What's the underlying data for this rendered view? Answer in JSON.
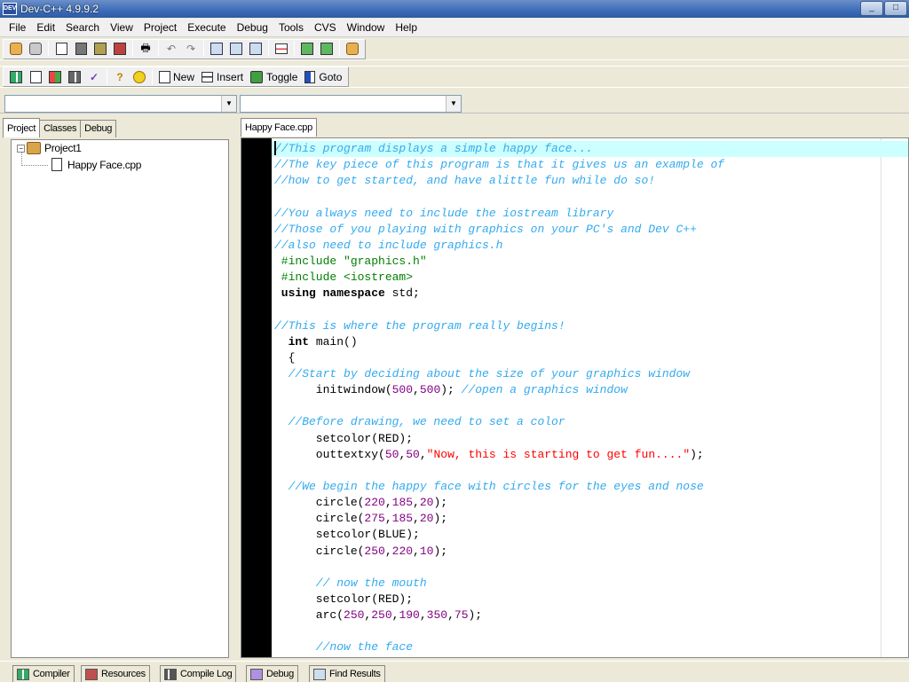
{
  "window": {
    "title": "Dev-C++ 4.9.9.2",
    "app_badge": "DEV"
  },
  "menu": [
    "File",
    "Edit",
    "Search",
    "View",
    "Project",
    "Execute",
    "Debug",
    "Tools",
    "CVS",
    "Window",
    "Help"
  ],
  "toolbar2": {
    "new_label": "New",
    "insert_label": "Insert",
    "toggle_label": "Toggle",
    "goto_label": "Goto"
  },
  "left_tabs": [
    "Project",
    "Classes",
    "Debug"
  ],
  "tree": {
    "project": "Project1",
    "file": "Happy Face.cpp"
  },
  "editor": {
    "tab_label": "Happy Face.cpp",
    "lines": [
      [
        [
          "cm",
          "//This program displays a simple happy face..."
        ]
      ],
      [
        [
          "cm",
          "//The key piece of this program is that it gives us an example of"
        ]
      ],
      [
        [
          "cm",
          "//how to get started, and have alittle fun while do so!"
        ]
      ],
      [],
      [
        [
          "cm",
          "//You always need to include the iostream library"
        ]
      ],
      [
        [
          "cm",
          "//Those of you playing with graphics on your PC's and Dev C++"
        ]
      ],
      [
        [
          "cm",
          "//also need to include graphics.h"
        ]
      ],
      [
        [
          "pp",
          " #include \"graphics.h\""
        ]
      ],
      [
        [
          "pp",
          " #include <iostream>"
        ]
      ],
      [
        [
          "kw",
          " using namespace "
        ],
        [
          "plain",
          "std;"
        ]
      ],
      [],
      [
        [
          "cm",
          "//This is where the program really begins!"
        ]
      ],
      [
        [
          "kw",
          "  int "
        ],
        [
          "plain",
          "main()"
        ]
      ],
      [
        [
          "plain",
          "  {"
        ]
      ],
      [
        [
          "cm",
          "  //Start by deciding about the size of your graphics window"
        ]
      ],
      [
        [
          "plain",
          "      initwindow("
        ],
        [
          "num",
          "500"
        ],
        [
          "plain",
          ","
        ],
        [
          "num",
          "500"
        ],
        [
          "plain",
          "); "
        ],
        [
          "cm",
          "//open a graphics window"
        ]
      ],
      [],
      [
        [
          "cm",
          "  //Before drawing, we need to set a color"
        ]
      ],
      [
        [
          "plain",
          "      setcolor(RED);"
        ]
      ],
      [
        [
          "plain",
          "      outtextxy("
        ],
        [
          "num",
          "50"
        ],
        [
          "plain",
          ","
        ],
        [
          "num",
          "50"
        ],
        [
          "plain",
          ","
        ],
        [
          "str",
          "\"Now, this is starting to get fun....\""
        ],
        [
          "plain",
          ");"
        ]
      ],
      [],
      [
        [
          "cm",
          "  //We begin the happy face with circles for the eyes and nose"
        ]
      ],
      [
        [
          "plain",
          "      circle("
        ],
        [
          "num",
          "220"
        ],
        [
          "plain",
          ","
        ],
        [
          "num",
          "185"
        ],
        [
          "plain",
          ","
        ],
        [
          "num",
          "20"
        ],
        [
          "plain",
          ");"
        ]
      ],
      [
        [
          "plain",
          "      circle("
        ],
        [
          "num",
          "275"
        ],
        [
          "plain",
          ","
        ],
        [
          "num",
          "185"
        ],
        [
          "plain",
          ","
        ],
        [
          "num",
          "20"
        ],
        [
          "plain",
          ");"
        ]
      ],
      [
        [
          "plain",
          "      setcolor(BLUE);"
        ]
      ],
      [
        [
          "plain",
          "      circle("
        ],
        [
          "num",
          "250"
        ],
        [
          "plain",
          ","
        ],
        [
          "num",
          "220"
        ],
        [
          "plain",
          ","
        ],
        [
          "num",
          "10"
        ],
        [
          "plain",
          ");"
        ]
      ],
      [],
      [
        [
          "cm",
          "      // now the mouth"
        ]
      ],
      [
        [
          "plain",
          "      setcolor(RED);"
        ]
      ],
      [
        [
          "plain",
          "      arc("
        ],
        [
          "num",
          "250"
        ],
        [
          "plain",
          ","
        ],
        [
          "num",
          "250"
        ],
        [
          "plain",
          ","
        ],
        [
          "num",
          "190"
        ],
        [
          "plain",
          ","
        ],
        [
          "num",
          "350"
        ],
        [
          "plain",
          ","
        ],
        [
          "num",
          "75"
        ],
        [
          "plain",
          ");"
        ]
      ],
      [],
      [
        [
          "cm",
          "      //now the face"
        ]
      ]
    ]
  },
  "bottom_tabs": [
    "Compiler",
    "Resources",
    "Compile Log",
    "Debug",
    "Find Results"
  ]
}
